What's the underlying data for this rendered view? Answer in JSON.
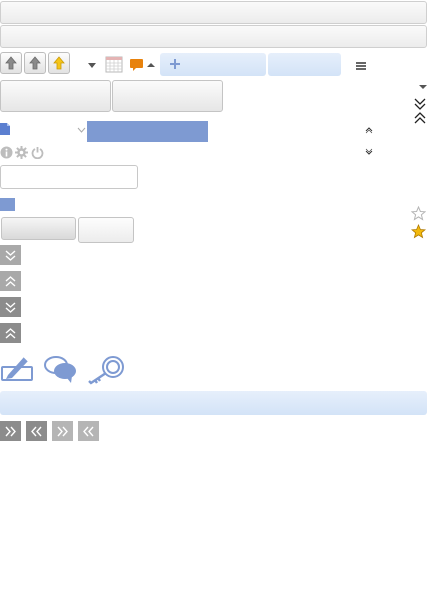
{
  "colors": {
    "accent_blue": "#7e9ad2",
    "light_blue": "#dbe7f8",
    "folder_orange": "#e8820c",
    "star_gold": "#f2b90d",
    "tile_grey": "#a9a9a9",
    "tile_dark": "#8c8c8c"
  },
  "toolbar": {
    "icons": [
      "up-arrow-icon",
      "up-arrow-icon",
      "up-arrow-yellow-icon",
      "dropdown-arrow-icon",
      "calendar-icon",
      "folder-icon",
      "caret-up-icon",
      "plus-icon",
      "menu-icon"
    ]
  },
  "rating": {
    "value": 1,
    "max": 2
  },
  "footer_icons": [
    "edit-icon",
    "chat-icon",
    "key-icon"
  ]
}
